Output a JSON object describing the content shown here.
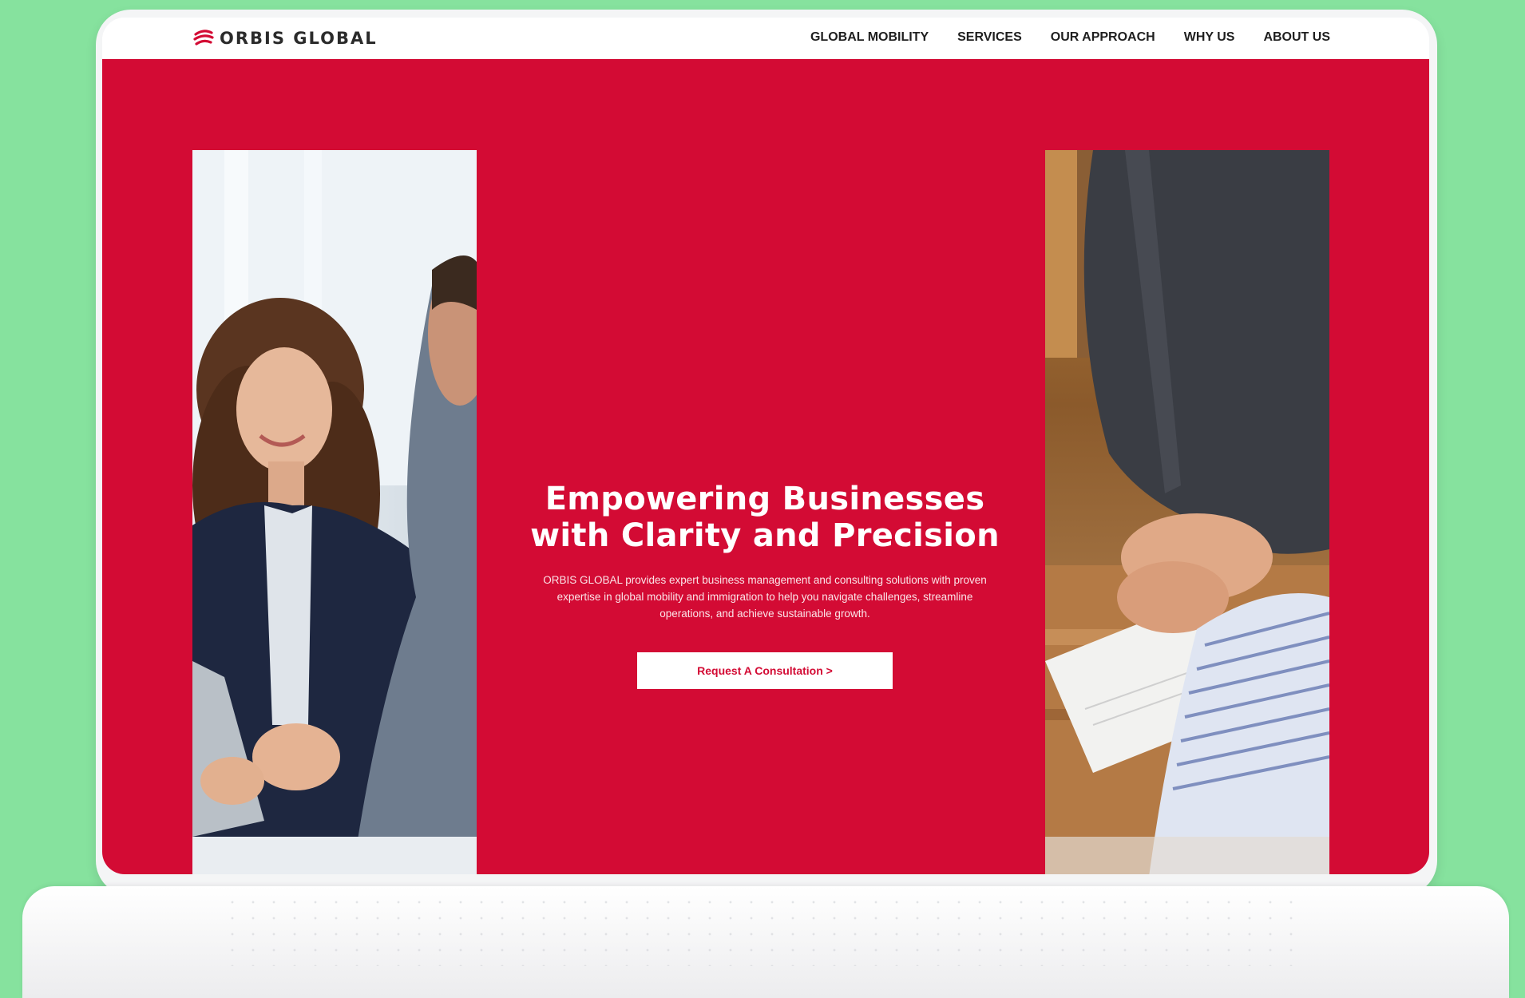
{
  "brand": {
    "name": "ORBIS GLOBAL",
    "accent_color": "#d30b34",
    "logo_icon": "swirl-logo-icon"
  },
  "nav": {
    "items": [
      {
        "label": "GLOBAL MOBILITY"
      },
      {
        "label": "SERVICES"
      },
      {
        "label": "OUR APPROACH"
      },
      {
        "label": "WHY US"
      },
      {
        "label": "ABOUT US"
      }
    ]
  },
  "hero": {
    "title_line1": "Empowering Businesses",
    "title_line2": "with Clarity and Precision",
    "description": "ORBIS GLOBAL provides expert business management and consulting solutions with proven expertise in global mobility and immigration to help you navigate challenges, streamline operations, and achieve sustainable growth.",
    "cta_label": "Request A Consultation >"
  },
  "background_color": "#86e29e"
}
